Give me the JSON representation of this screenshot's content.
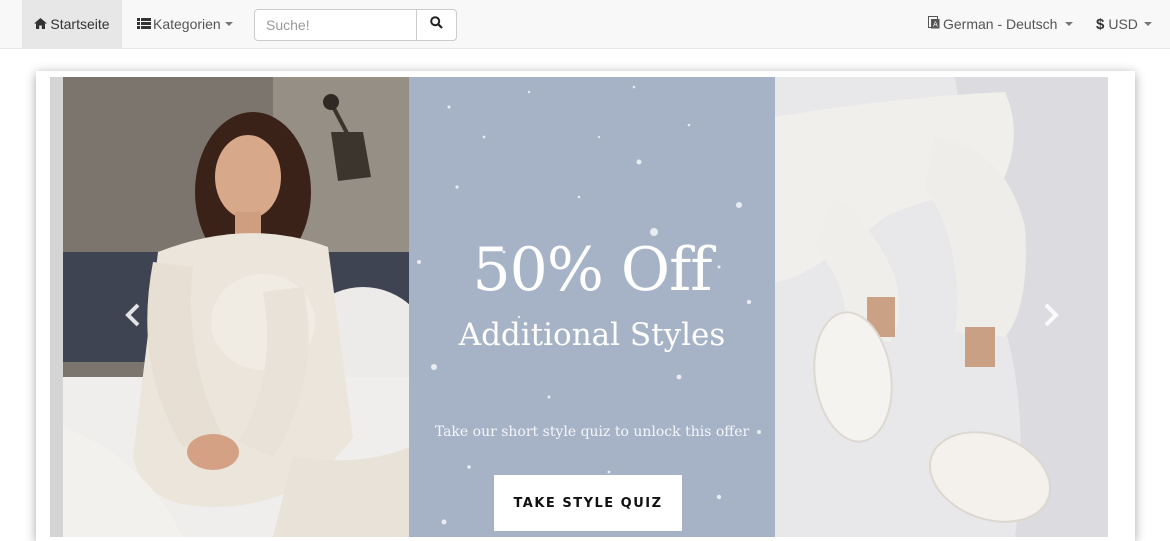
{
  "navbar": {
    "home_label": "Startseite",
    "categories_label": "Kategorien",
    "search": {
      "placeholder": "Suche!",
      "value": ""
    },
    "language_label": "German - Deutsch",
    "currency_symbol": "$",
    "currency_label": "USD"
  },
  "icons": {
    "home": "home-icon",
    "categories": "list-icon",
    "search": "search-icon",
    "language": "language-icon",
    "prev": "chevron-left-icon",
    "next": "chevron-right-icon"
  },
  "carousel": {
    "slide": {
      "headline": "50% Off",
      "subheadline": "Additional Styles",
      "note": "Take our short style quiz to unlock this offer",
      "cta_label": "TAKE STYLE QUIZ"
    }
  },
  "colors": {
    "navbar_bg": "#f8f8f8",
    "promo_panel": "#a6b3c7",
    "cta_bg": "#ffffff"
  }
}
